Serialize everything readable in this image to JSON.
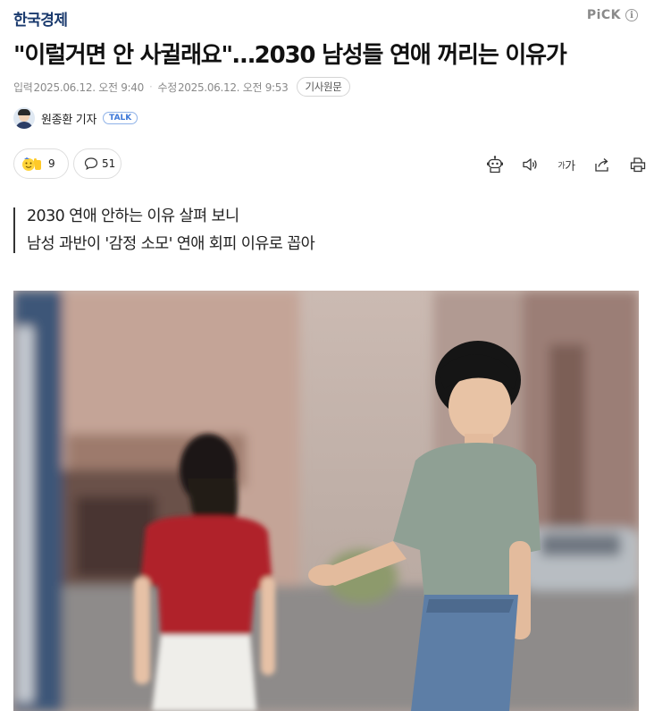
{
  "header": {
    "logo_text": "한국경제",
    "pick_label": "PiCK",
    "info_icon_glyph": "i"
  },
  "article": {
    "headline": "\"이럴거면 안 사귈래요\"…2030 남성들 연애 꺼리는 이유가",
    "published_label": "입력",
    "published": "2025.06.12. 오전 9:40",
    "modified_label": "수정",
    "modified": "2025.06.12. 오전 9:53",
    "original_button": "기사원문",
    "reporter": "원종환 기자",
    "talk_badge": "TALK",
    "summary": [
      "2030 연애 안하는 이유 살펴 보니",
      "남성 과반이 '감정 소모' 연애 회피 이유로 꼽아"
    ]
  },
  "actions": {
    "reaction_count": "9",
    "comment_count": "51",
    "font_size_small": "가",
    "font_size_large": "가",
    "icons": [
      "reaction-emoji-icon",
      "comment-icon",
      "robot-summary-icon",
      "speaker-icon",
      "font-size-icon",
      "share-icon",
      "print-icon"
    ]
  },
  "photo": {
    "subject": "young man and woman on street"
  },
  "colors": {
    "logo": "#1a3a6e",
    "accent_blue": "#3d78d8",
    "text_gray": "#8a8a8a"
  }
}
